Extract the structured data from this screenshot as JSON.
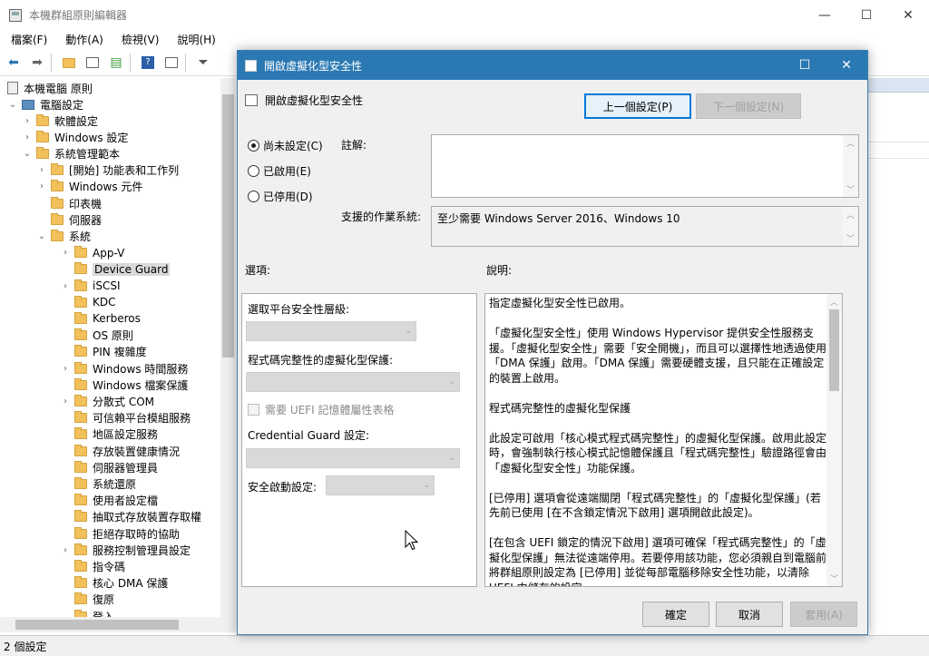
{
  "window": {
    "title": "本機群組原則編輯器",
    "min": "—",
    "max": "☐",
    "close": "✕"
  },
  "menu": [
    "檔案(F)",
    "動作(A)",
    "檢視(V)",
    "說明(H)"
  ],
  "toolbar_icons": [
    "back-icon",
    "forward-icon",
    "folder-up-icon",
    "show-hide-tree-icon",
    "export-list-icon",
    "help-icon",
    "properties-icon",
    "filter-icon"
  ],
  "tree": {
    "root": "本機電腦 原則",
    "computer_config": "電腦設定",
    "items": [
      {
        "label": "軟體設定",
        "level": 2,
        "chev": "›"
      },
      {
        "label": "Windows 設定",
        "level": 2,
        "chev": "›"
      },
      {
        "label": "系統管理範本",
        "level": 2,
        "chev": "⌄"
      },
      {
        "label": "[開始] 功能表和工作列",
        "level": 3,
        "chev": "›"
      },
      {
        "label": "Windows 元件",
        "level": 3,
        "chev": "›"
      },
      {
        "label": "印表機",
        "level": 3,
        "chev": ""
      },
      {
        "label": "伺服器",
        "level": 3,
        "chev": ""
      },
      {
        "label": "系統",
        "level": 3,
        "chev": "⌄"
      },
      {
        "label": "App-V",
        "level": 4,
        "chev": "›"
      },
      {
        "label": "Device Guard",
        "level": 4,
        "chev": "",
        "selected": true
      },
      {
        "label": "iSCSI",
        "level": 4,
        "chev": "›"
      },
      {
        "label": "KDC",
        "level": 4,
        "chev": ""
      },
      {
        "label": "Kerberos",
        "level": 4,
        "chev": ""
      },
      {
        "label": "OS 原則",
        "level": 4,
        "chev": ""
      },
      {
        "label": "PIN 複雜度",
        "level": 4,
        "chev": ""
      },
      {
        "label": "Windows 時間服務",
        "level": 4,
        "chev": "›"
      },
      {
        "label": "Windows 檔案保護",
        "level": 4,
        "chev": ""
      },
      {
        "label": "分散式 COM",
        "level": 4,
        "chev": "›"
      },
      {
        "label": "可信賴平台模組服務",
        "level": 4,
        "chev": ""
      },
      {
        "label": "地區設定服務",
        "level": 4,
        "chev": ""
      },
      {
        "label": "存放裝置健康情況",
        "level": 4,
        "chev": ""
      },
      {
        "label": "伺服器管理員",
        "level": 4,
        "chev": ""
      },
      {
        "label": "系統還原",
        "level": 4,
        "chev": ""
      },
      {
        "label": "使用者設定檔",
        "level": 4,
        "chev": ""
      },
      {
        "label": "抽取式存放裝置存取權",
        "level": 4,
        "chev": ""
      },
      {
        "label": "拒絕存取時的協助",
        "level": 4,
        "chev": ""
      },
      {
        "label": "服務控制管理員設定",
        "level": 4,
        "chev": "›"
      },
      {
        "label": "指令碼",
        "level": 4,
        "chev": ""
      },
      {
        "label": "核心 DMA 保護",
        "level": 4,
        "chev": ""
      },
      {
        "label": "復原",
        "level": 4,
        "chev": ""
      },
      {
        "label": "登入",
        "level": 4,
        "chev": ""
      }
    ]
  },
  "status": "2 個設定",
  "dialog": {
    "title": "開啟虛擬化型安全性",
    "setting_name": "開啟虛擬化型安全性",
    "prev_button": "上一個設定(P)",
    "next_button": "下一個設定(N)",
    "radios": [
      {
        "label": "尚未設定(C)",
        "checked": true
      },
      {
        "label": "已啟用(E)",
        "checked": false
      },
      {
        "label": "已停用(D)",
        "checked": false
      }
    ],
    "comment_label": "註解:",
    "supported_label": "支援的作業系統:",
    "supported_value": "至少需要 Windows Server 2016、Windows 10",
    "options_label": "選項:",
    "help_label": "說明:",
    "options": {
      "platform_label": "選取平台安全性層級:",
      "ci_label": "程式碼完整性的虛擬化型保護:",
      "uefi_checkbox": "需要 UEFI 記憶體屬性表格",
      "cg_label": "Credential Guard 設定:",
      "secure_launch_label": "安全啟動設定:"
    },
    "help_text": "指定虛擬化型安全性已啟用。\n\n「虛擬化型安全性」使用 Windows Hypervisor 提供安全性服務支援。「虛擬化型安全性」需要「安全開機」，而且可以選擇性地透過使用「DMA 保護」啟用。「DMA 保護」需要硬體支援，且只能在正確設定的裝置上啟用。\n\n程式碼完整性的虛擬化型保護\n\n此設定可啟用「核心模式程式碼完整性」的虛擬化型保護。啟用此設定時，會強制執行核心模式記憶體保護且「程式碼完整性」驗證路徑會由「虛擬化型安全性」功能保護。\n\n[已停用] 選項會從遠端關閉「程式碼完整性」的「虛擬化型保護」(若先前已使用 [在不含鎖定情況下啟用] 選項開啟此設定)。\n\n[在包含 UEFI 鎖定的情況下啟用] 選項可確保「程式碼完整性」的「虛擬化型保護」無法從遠端停用。若要停用該功能，您必須親自到電腦前將群組原則設定為 [已停用] 並從每部電腦移除安全性功能，以清除 UEFI 中儲存的設定。",
    "ok_button": "確定",
    "cancel_button": "取消",
    "apply_button": "套用(A)"
  },
  "colors": {
    "accent": "#2b79b3",
    "selection": "#d9d9d9",
    "folder": "#f2c15c"
  }
}
